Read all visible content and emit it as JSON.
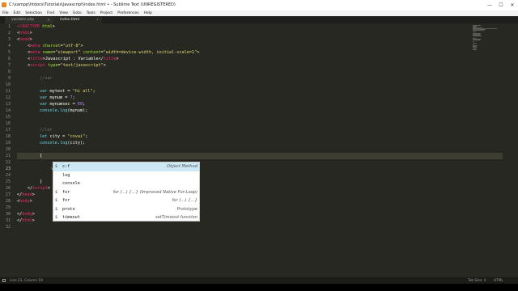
{
  "window": {
    "title": "C:\\xampp\\htdocs\\Tutorials\\javascript\\index.html • - Sublime Text (UNREGISTERED)",
    "controls": [
      "—",
      "☐",
      "✕"
    ]
  },
  "menu": [
    "File",
    "Edit",
    "Selection",
    "Find",
    "View",
    "Goto",
    "Tools",
    "Project",
    "Preferences",
    "Help"
  ],
  "tabs": [
    {
      "label": "variable.php"
    },
    {
      "label": "index.html"
    }
  ],
  "editor": {
    "line_numbers": [
      "1",
      "2",
      "3",
      "4",
      "5",
      "6",
      "7",
      "8",
      "9",
      "10",
      "11",
      "12",
      "13",
      "14",
      "15",
      "16",
      "17",
      "18",
      "19",
      "20",
      "21",
      "22",
      "23",
      "24",
      "25",
      "26",
      "27",
      "28",
      "29",
      "30",
      "31",
      "32"
    ],
    "active_line_number": "23",
    "lines": {
      "l1a": "<!DOCTYPE",
      "l1b": " html",
      "l1c": ">",
      "l2a": "<",
      "l2b": "html",
      "l2c": ">",
      "l3a": "<",
      "l3b": "head",
      "l3c": ">",
      "l4a": "<",
      "l4b": "meta",
      "l4c": "charset",
      "l4d": "=",
      "l4e": "\"utf-8\"",
      "l4f": ">",
      "l5a": "<",
      "l5b": "meta",
      "l5c": "name",
      "l5d": "=",
      "l5e": "\"viewport\"",
      "l5f": "content",
      "l5g": "=",
      "l5h": "\"width=device-width, initial-scale=1\"",
      "l5i": ">",
      "l6a": "<",
      "l6b": "title",
      "l6c": ">Javascript : Variable</",
      "l6d": "title",
      "l6e": ">",
      "l7a": "<",
      "l7b": "script",
      "l7c": "type",
      "l7d": "=",
      "l7e": "\"text/javascript\"",
      "l7f": ">",
      "l9": "//var",
      "l11a": "var",
      "l11b": " mytext = ",
      "l11c": "\"hi all\"",
      "l11d": ";",
      "l12a": "var",
      "l12b": " mynum = ",
      "l12c": "7",
      "l12d": ";",
      "l13a": "var",
      "l13b": " mynumsec = ",
      "l13c": "60",
      "l13d": ";",
      "l14a": "console",
      "l14b": ".",
      "l14c": "log",
      "l14d": "(mynum);",
      "l17": "//let",
      "l18a": "let",
      "l18b": " city = ",
      "l18c": "\"covai\"",
      "l18d": ";",
      "l19a": "console",
      "l19b": ".",
      "l19c": "log",
      "l19d": "(city);",
      "l21": "{",
      "l23a": "var",
      "l23b": " c",
      "l25": "}",
      "l26a": "</",
      "l26b": "script",
      "l26c": ">",
      "l27a": "</",
      "l27b": "head",
      "l27c": ">",
      "l28a": "<",
      "l28b": "body",
      "l28c": ">",
      "l30a": "</",
      "l30b": "body",
      "l30c": ">",
      "l31a": "</",
      "l31b": "html",
      "l31c": ">"
    }
  },
  "autocomplete": {
    "items": [
      {
        "kind": "$",
        "label": "c:f",
        "hint": "Object Method"
      },
      {
        "kind": "",
        "label": "log",
        "hint": ""
      },
      {
        "kind": "",
        "label": "console",
        "hint": ""
      },
      {
        "kind": "$",
        "label": "for",
        "hint": "for (…) {…} (Improved Native For-Loop)"
      },
      {
        "kind": "$",
        "label": "for",
        "hint": "for (…) {…}"
      },
      {
        "kind": "$",
        "label": "proto",
        "hint": "Prototype"
      },
      {
        "kind": "$",
        "label": "timeout",
        "hint": "setTimeout function"
      }
    ]
  },
  "status": {
    "position": "Line 23, Column 18",
    "tab_size": "Tab Size: 4",
    "syntax": "HTML"
  },
  "colors": {
    "editor_bg": "#272822",
    "tag": "#f92672",
    "attribute": "#a6e22e",
    "string": "#e6db74",
    "keyword": "#66d9ef",
    "number": "#ae81ff",
    "comment": "#75715e"
  }
}
